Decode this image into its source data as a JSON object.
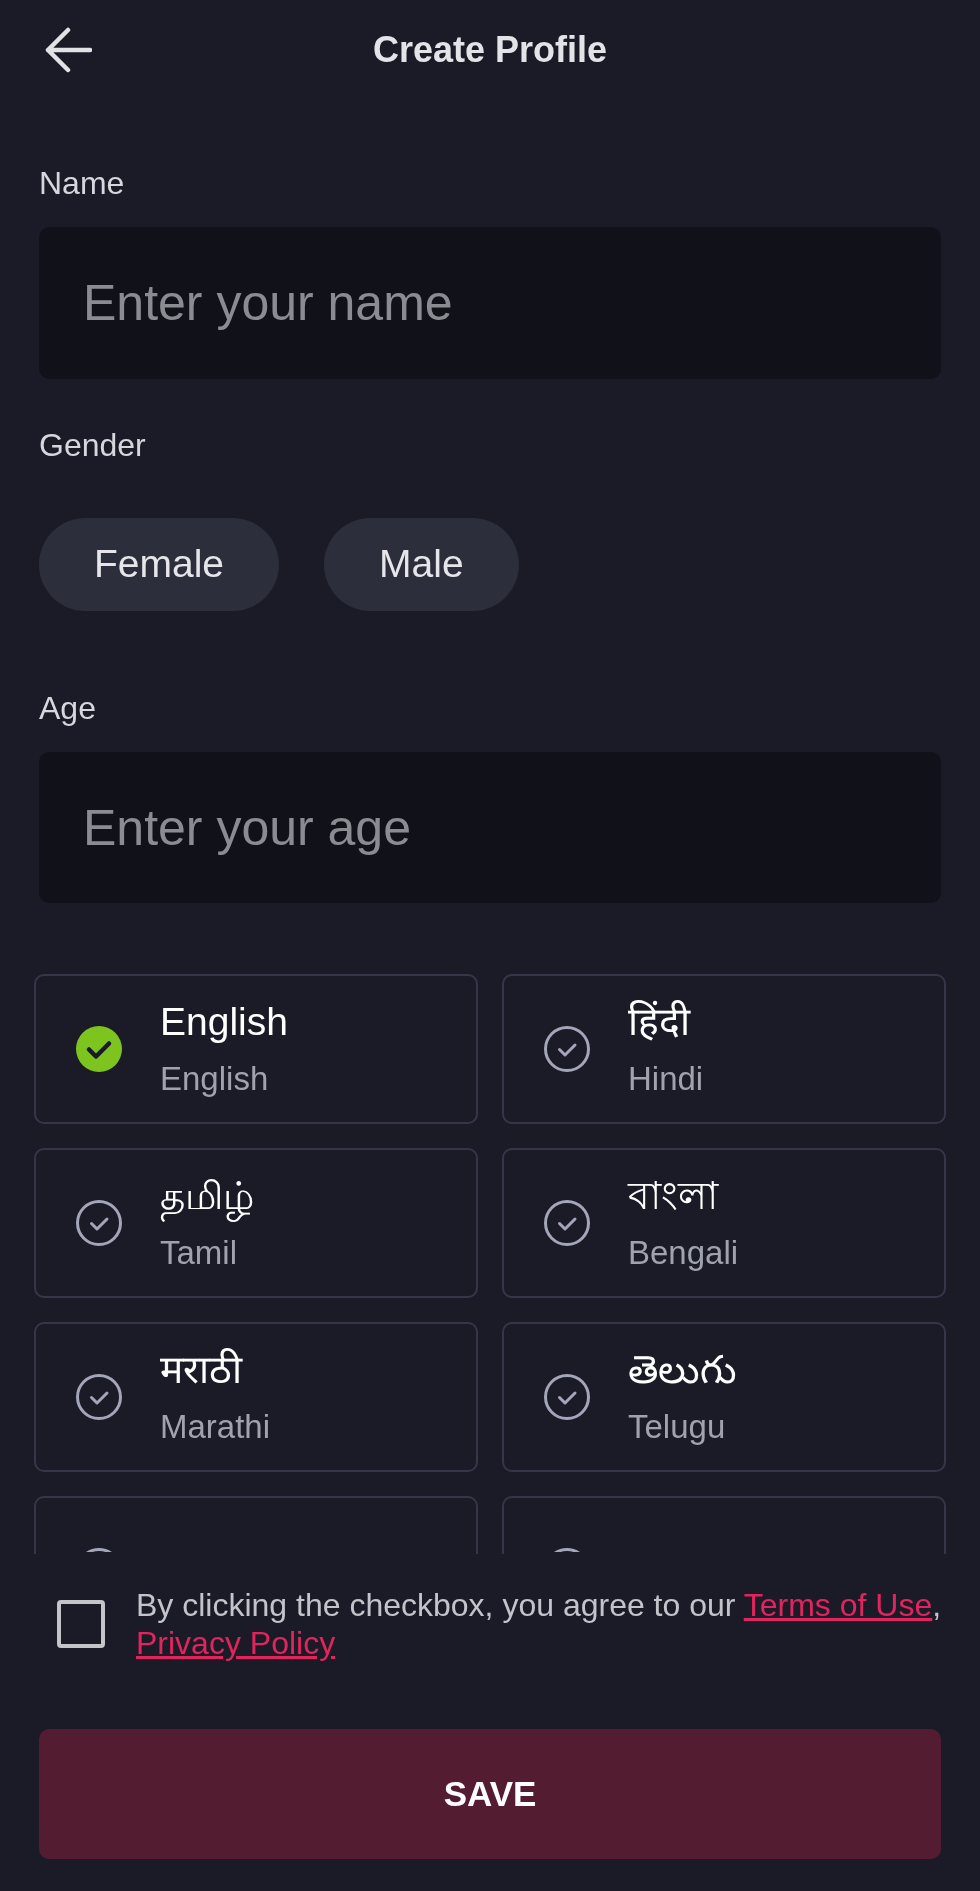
{
  "header": {
    "title": "Create Profile"
  },
  "name_field": {
    "label": "Name",
    "placeholder": "Enter your name"
  },
  "gender": {
    "label": "Gender",
    "options": [
      {
        "label": "Female",
        "selected": false
      },
      {
        "label": "Male",
        "selected": false
      }
    ]
  },
  "age_field": {
    "label": "Age",
    "placeholder": "Enter your age"
  },
  "languages": [
    {
      "native": "English",
      "name": "English",
      "selected": true
    },
    {
      "native": "हिंदी",
      "name": "Hindi",
      "selected": false
    },
    {
      "native": "தமிழ்",
      "name": "Tamil",
      "selected": false
    },
    {
      "native": "বাংলা",
      "name": "Bengali",
      "selected": false
    },
    {
      "native": "मराठी",
      "name": "Marathi",
      "selected": false
    },
    {
      "native": "తెలుగు",
      "name": "Telugu",
      "selected": false
    },
    {
      "selected": false
    },
    {
      "selected": false
    }
  ],
  "consent": {
    "checked": false,
    "parts": [
      {
        "kind": "text",
        "text": "By clicking the checkbox, you agree to our "
      },
      {
        "kind": "link",
        "text": "Terms of Use"
      },
      {
        "kind": "text",
        "text": ", "
      },
      {
        "kind": "link",
        "text": "Privacy Policy"
      }
    ]
  },
  "save_button": {
    "label": "SAVE"
  }
}
